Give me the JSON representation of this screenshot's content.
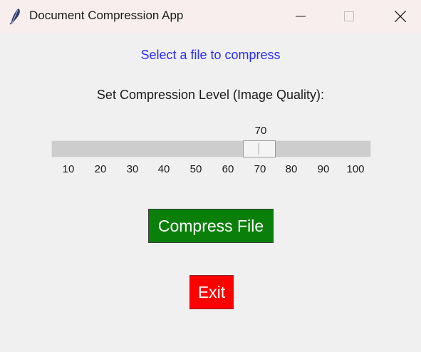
{
  "window": {
    "title": "Document Compression App",
    "minimize_icon": "minimize-icon",
    "maximize_icon": "maximize-icon",
    "close_icon": "close-icon",
    "app_icon": "feather-icon"
  },
  "main": {
    "status_text": "Select a file to compress",
    "status_color": "#2b2bff",
    "slider_label": "Set Compression Level (Image Quality):",
    "slider": {
      "value": "70",
      "min": 10,
      "max": 100,
      "tick_labels": [
        "10",
        "20",
        "30",
        "40",
        "50",
        "60",
        "70",
        "80",
        "90",
        "100"
      ]
    },
    "compress_button": {
      "label": "Compress File",
      "color": "#0a800a"
    },
    "exit_button": {
      "label": "Exit",
      "color": "#ff0000"
    }
  }
}
